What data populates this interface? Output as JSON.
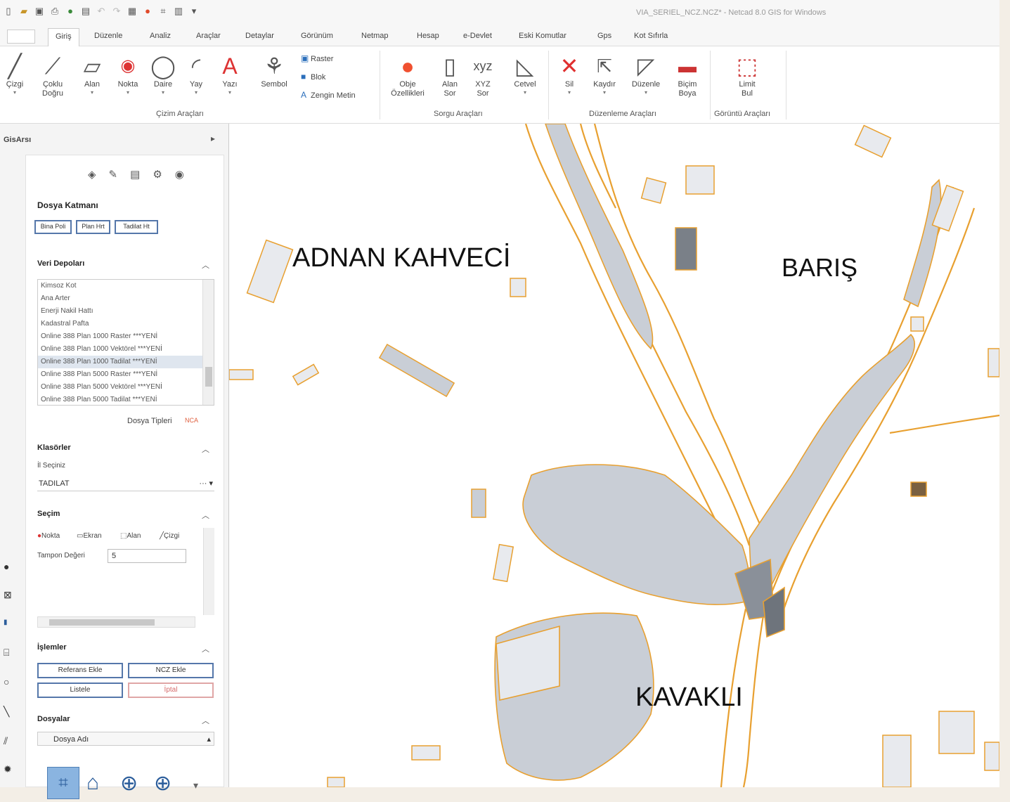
{
  "window": {
    "title": "VIA_SERIEL_NCZ.NCZ* - Netcad 8.0 GIS for Windows"
  },
  "ribbon": {
    "tabs": [
      "Giriş",
      "Düzenle",
      "Analiz",
      "Araçlar",
      "Detaylar",
      "Görünüm",
      "Netmap",
      "Hesap",
      "e-Devlet",
      "Eski Komutlar",
      "Gps",
      "Kot Sıfırla"
    ],
    "buttons": {
      "cizgi": "Çizgi",
      "coklu1": "Çoklu",
      "coklu2": "Doğru",
      "alan": "Alan",
      "nokta": "Nokta",
      "daire": "Daire",
      "yay": "Yay",
      "yazi": "Yazı",
      "sembol": "Sembol",
      "raster": "Raster",
      "blok": "Blok",
      "zengin": "Zengin Metin",
      "obje1": "Obje",
      "obje2": "Özellikleri",
      "alansor1": "Alan",
      "alansor2": "Sor",
      "xyz1": "XYZ",
      "xyz2": "Sor",
      "cetvel": "Cetvel",
      "sil": "Sil",
      "kaydir": "Kaydır",
      "duzenle": "Düzenle",
      "bicim1": "Biçim",
      "bicim2": "Boya",
      "limit1": "Limit",
      "limit2": "Bul"
    },
    "groups": {
      "cizim": "Çizim Araçları",
      "sorgu": "Sorgu Araçları",
      "duzenleme": "Düzenleme Araçları",
      "goruntu": "Görüntü Araçları"
    }
  },
  "dock": {
    "title": "GisArsı",
    "panel_title": "Dosya Katmanı",
    "filter_buttons": [
      "Bina Poli",
      "Plan Hrt",
      "Tadilat Ht"
    ],
    "sections": {
      "depolar": "Veri Depoları",
      "klasorler": "Klasörler",
      "secim": "Seçim",
      "islemler": "İşlemler",
      "dosyalar": "Dosyalar"
    },
    "depot_items": [
      "Kimsoz Kot",
      "Ana Arter",
      "Enerji Nakil Hattı",
      "Kadastral Pafta",
      "Online 388 Plan 1000 Raster  ***YENİ",
      "Online 388 Plan 1000 Vektörel  ***YENİ",
      "Online 388 Plan 1000 Tadilat  ***YENİ",
      "Online 388 Plan 5000 Raster  ***YENİ",
      "Online 388 Plan 5000 Vektörel  ***YENİ",
      "Online 388 Plan 5000 Tadilat  ***YENİ"
    ],
    "selected_depot_index": 6,
    "dosya_tipleri_label": "Dosya Tipleri",
    "dosya_tipleri_value": "NCA",
    "il_seciniz": "İl Seçiniz",
    "klasor_value": "TADILAT",
    "secim_options": [
      "Nokta",
      "Ekran",
      "Alan",
      "Çizgi"
    ],
    "tampon_label": "Tampon Değeri",
    "tampon_value": "5",
    "actions": {
      "referans": "Referans Ekle",
      "ncz": "NCZ Ekle",
      "listele": "Listele",
      "iptal": "İptal"
    },
    "dosyalar_value": "Dosya Adı"
  },
  "map": {
    "labels": [
      "ADNAN KAHVECİ",
      "BARIŞ",
      "KAVAKLI"
    ],
    "colors": {
      "boundary": "#e8a030",
      "parcel": "#9aa3ad",
      "parcel_fill": "#c9ced6"
    }
  }
}
